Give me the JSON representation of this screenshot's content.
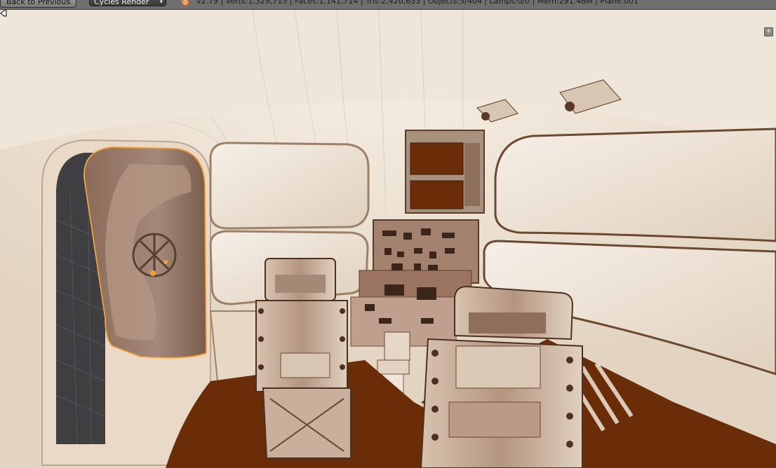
{
  "header": {
    "back_button_label": "Back to Previous",
    "render_engine": "Cycles Render",
    "stats": "v2.79 | Verts:1,329,715 | Faces:1,141,714 | Tris:2,420,633 | Objects:3/404 | Lamps:0/0 | Mem:291.46M | Plane.001"
  },
  "viewport": {
    "corner_widget_label": "+"
  },
  "colors": {
    "header_bg": "#6f6f6f",
    "viewport_bg": "#ece1d3",
    "floor": "#6b2d07",
    "selection_outline": "#f3a23c",
    "dark_wall": "#3f3f42"
  }
}
